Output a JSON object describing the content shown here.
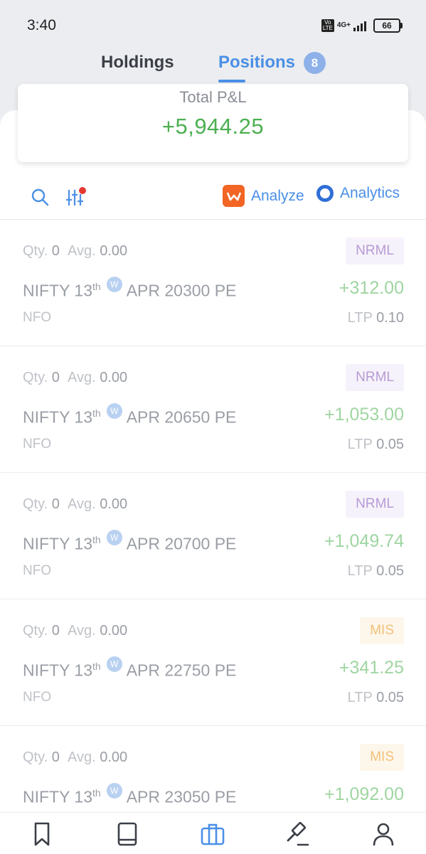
{
  "status": {
    "time": "3:40",
    "volte": "Vo LTE",
    "network": "4G+",
    "battery": "66"
  },
  "tabs": [
    {
      "label": "Holdings",
      "active": false
    },
    {
      "label": "Positions",
      "active": true,
      "badge": "8"
    }
  ],
  "summary": {
    "label": "Total P&L",
    "value": "+5,944.25"
  },
  "toolbar": {
    "search_icon": "search-icon",
    "filter_icon": "filter-sliders-icon",
    "analyze_label": "Analyze",
    "analytics_label": "Analytics"
  },
  "positions": [
    {
      "qty_label": "Qty.",
      "qty": "0",
      "avg_label": "Avg.",
      "avg": "0.00",
      "product": "NRML",
      "symbol": "NIFTY 13",
      "sup": "th",
      "weekly": "W",
      "rest": "APR 20300 PE",
      "pnl": "+312.00",
      "exchange": "NFO",
      "ltp_label": "LTP",
      "ltp": "0.10"
    },
    {
      "qty_label": "Qty.",
      "qty": "0",
      "avg_label": "Avg.",
      "avg": "0.00",
      "product": "NRML",
      "symbol": "NIFTY 13",
      "sup": "th",
      "weekly": "W",
      "rest": "APR 20650 PE",
      "pnl": "+1,053.00",
      "exchange": "NFO",
      "ltp_label": "LTP",
      "ltp": "0.05"
    },
    {
      "qty_label": "Qty.",
      "qty": "0",
      "avg_label": "Avg.",
      "avg": "0.00",
      "product": "NRML",
      "symbol": "NIFTY 13",
      "sup": "th",
      "weekly": "W",
      "rest": "APR 20700 PE",
      "pnl": "+1,049.74",
      "exchange": "NFO",
      "ltp_label": "LTP",
      "ltp": "0.05"
    },
    {
      "qty_label": "Qty.",
      "qty": "0",
      "avg_label": "Avg.",
      "avg": "0.00",
      "product": "MIS",
      "symbol": "NIFTY 13",
      "sup": "th",
      "weekly": "W",
      "rest": "APR 22750 PE",
      "pnl": "+341.25",
      "exchange": "NFO",
      "ltp_label": "LTP",
      "ltp": "0.05"
    },
    {
      "qty_label": "Qty.",
      "qty": "0",
      "avg_label": "Avg.",
      "avg": "0.00",
      "product": "MIS",
      "symbol": "NIFTY 13",
      "sup": "th",
      "weekly": "W",
      "rest": "APR 23050 PE",
      "pnl": "+1,092.00"
    }
  ],
  "bottom_nav": [
    {
      "icon": "bookmark-icon",
      "active": false
    },
    {
      "icon": "book-icon",
      "active": false
    },
    {
      "icon": "briefcase-icon",
      "active": true
    },
    {
      "icon": "gavel-icon",
      "active": false
    },
    {
      "icon": "user-icon",
      "active": false
    }
  ],
  "colors": {
    "accent": "#4a8fe6",
    "profit": "#4caf50",
    "analyze_brand": "#f26524"
  }
}
